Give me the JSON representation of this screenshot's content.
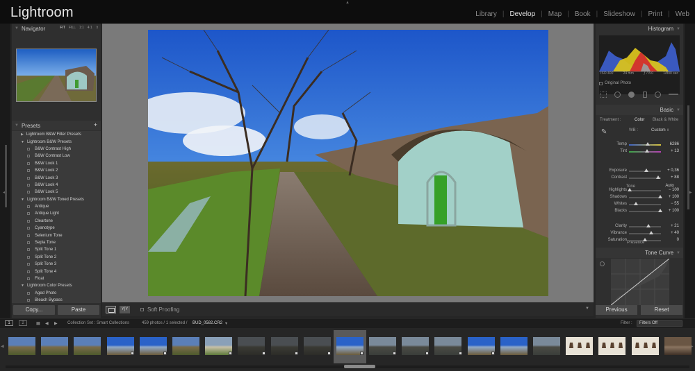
{
  "app": {
    "title": "Lightroom"
  },
  "modules": [
    "Library",
    "Develop",
    "Map",
    "Book",
    "Slideshow",
    "Print",
    "Web"
  ],
  "active_module": "Develop",
  "navigator": {
    "title": "Navigator",
    "options": [
      "FIT",
      "FILL",
      "1:1",
      "4:1"
    ]
  },
  "presets": {
    "title": "Presets",
    "add_label": "+",
    "rows": [
      {
        "label": "Lightroom B&W Filter Presets",
        "folder": true
      },
      {
        "label": "Lightroom B&W Presets",
        "folder": true
      },
      {
        "label": "B&W Contrast High",
        "folder": false
      },
      {
        "label": "B&W Contrast Low",
        "folder": false
      },
      {
        "label": "B&W Look 1",
        "folder": false
      },
      {
        "label": "B&W Look 2",
        "folder": false
      },
      {
        "label": "B&W Look 3",
        "folder": false
      },
      {
        "label": "B&W Look 4",
        "folder": false
      },
      {
        "label": "B&W Look 5",
        "folder": false
      },
      {
        "label": "Lightroom B&W Toned Presets",
        "folder": true
      },
      {
        "label": "Antique",
        "folder": false
      },
      {
        "label": "Antique Light",
        "folder": false
      },
      {
        "label": "Cleartone",
        "folder": false
      },
      {
        "label": "Cyanotype",
        "folder": false
      },
      {
        "label": "Selenium Tone",
        "folder": false
      },
      {
        "label": "Sepia Tone",
        "folder": false
      },
      {
        "label": "Split Tone 1",
        "folder": false
      },
      {
        "label": "Split Tone 2",
        "folder": false
      },
      {
        "label": "Split Tone 3",
        "folder": false
      },
      {
        "label": "Split Tone 4",
        "folder": false
      },
      {
        "label": "Float",
        "folder": false
      },
      {
        "label": "Lightroom Color Presets",
        "folder": true
      },
      {
        "label": "Aged Photo",
        "folder": false
      },
      {
        "label": "Bleach Bypass",
        "folder": false
      }
    ]
  },
  "left_buttons": {
    "copy": "Copy...",
    "paste": "Paste"
  },
  "toolbar": {
    "soft_proofing": "Soft Proofing",
    "compare_label": "Y|Y"
  },
  "histogram": {
    "title": "Histogram",
    "iso": "ISO 400",
    "focal": "24 mm",
    "aperture": "ƒ / 8.0",
    "shutter": "1/800 sec",
    "original_photo": "Original Photo"
  },
  "basic": {
    "title": "Basic",
    "treatment_label": "Treatment :",
    "treatment_options": [
      "Color",
      "Black & White"
    ],
    "treatment_selected": "Color",
    "wb_label": "WB :",
    "wb_value": "Custom",
    "tone_label": "Tone",
    "auto_label": "Auto",
    "presence_label": "Presence",
    "sliders_wb": [
      {
        "label": "Temp",
        "value": "6286",
        "pos": 0.58
      },
      {
        "label": "Tint",
        "value": "+ 13",
        "pos": 0.56
      }
    ],
    "sliders_tone": [
      {
        "label": "Exposure",
        "value": "+ 0,36",
        "pos": 0.55
      },
      {
        "label": "Contrast",
        "value": "+ 88",
        "pos": 0.92
      },
      {
        "label": "Highlights",
        "value": "− 100",
        "pos": 0.02
      },
      {
        "label": "Shadows",
        "value": "+ 100",
        "pos": 0.98
      },
      {
        "label": "Whites",
        "value": "− 55",
        "pos": 0.22
      },
      {
        "label": "Blacks",
        "value": "+ 100",
        "pos": 0.98
      }
    ],
    "sliders_presence": [
      {
        "label": "Clarity",
        "value": "+ 21",
        "pos": 0.6
      },
      {
        "label": "Vibrance",
        "value": "+ 40",
        "pos": 0.7
      },
      {
        "label": "Saturation",
        "value": "0",
        "pos": 0.5
      }
    ]
  },
  "tone_curve": {
    "title": "Tone Curve"
  },
  "right_buttons": {
    "previous": "Previous",
    "reset": "Reset"
  },
  "filmbar": {
    "page1": "1",
    "page2": "2",
    "source": "Collection Set : Smart Collections",
    "count": "459 photos / 1 selected /",
    "filename": "BUD_0582.CR2",
    "filter_label": "Filter :",
    "filter_value": "Filters Off"
  },
  "filmstrip": {
    "selected_index": 10,
    "thumbs": [
      {
        "kind": "land"
      },
      {
        "kind": "land"
      },
      {
        "kind": "land"
      },
      {
        "kind": "sky",
        "badge": true
      },
      {
        "kind": "sky",
        "badge": true
      },
      {
        "kind": "land"
      },
      {
        "kind": "house",
        "badge": true
      },
      {
        "kind": "dark",
        "badge": true
      },
      {
        "kind": "dark",
        "badge": true
      },
      {
        "kind": "dark",
        "badge": true
      },
      {
        "kind": "sky",
        "badge": true
      },
      {
        "kind": "grey",
        "badge": true
      },
      {
        "kind": "grey",
        "badge": true
      },
      {
        "kind": "grey",
        "badge": true
      },
      {
        "kind": "sky",
        "badge": true
      },
      {
        "kind": "sky"
      },
      {
        "kind": "grey"
      },
      {
        "kind": "bells"
      },
      {
        "kind": "bells"
      },
      {
        "kind": "bells"
      },
      {
        "kind": "brown"
      }
    ]
  }
}
